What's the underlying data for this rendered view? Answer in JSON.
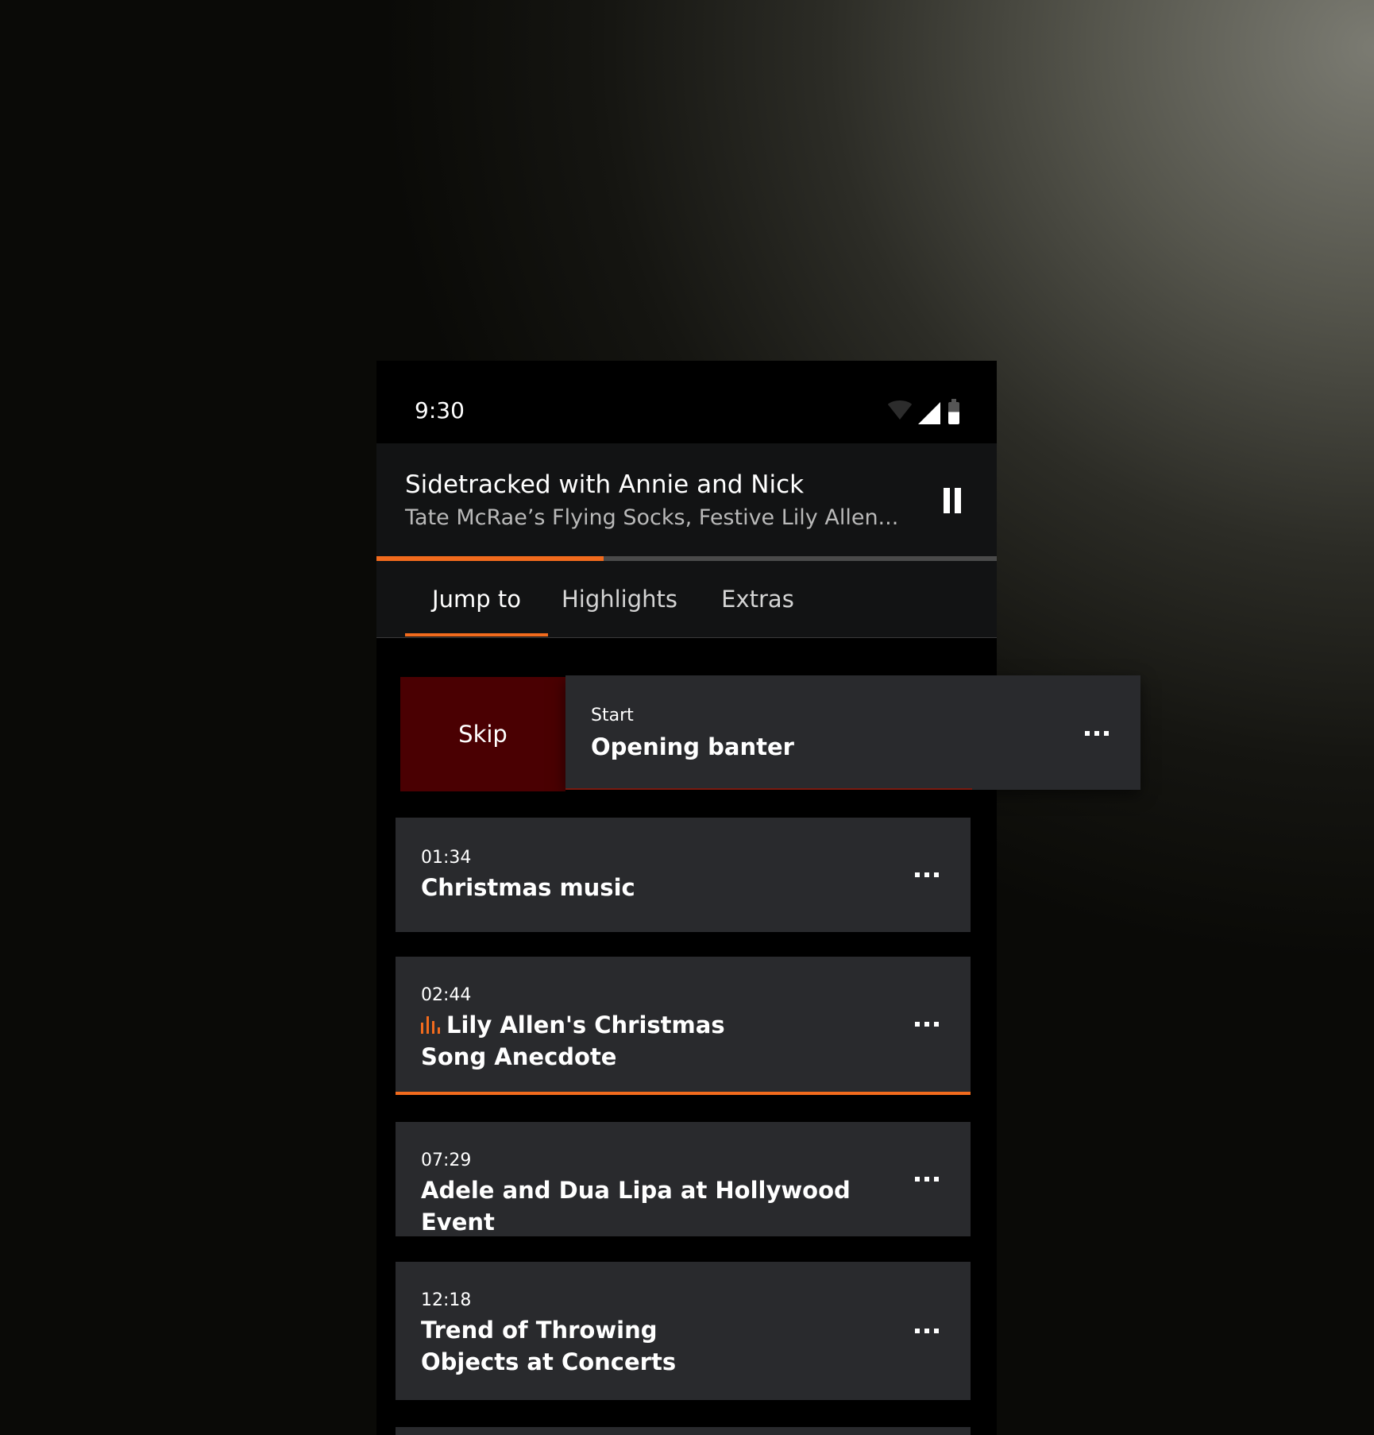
{
  "status_bar": {
    "time": "9:30",
    "icons": [
      "wifi-icon",
      "signal-icon",
      "battery-icon"
    ]
  },
  "now_playing": {
    "title": "Sidetracked with Annie and Nick",
    "subtitle": "Tate McRae’s Flying Socks, Festive Lily Allen...",
    "progress_fraction": 0.366,
    "pause_icon": "pause-icon"
  },
  "tabs": [
    {
      "label": "Jump to",
      "active": true
    },
    {
      "label": "Highlights",
      "active": false
    },
    {
      "label": "Extras",
      "active": false
    }
  ],
  "swipe_item": {
    "action_label": "Skip",
    "time": "Start",
    "title": "Opening banter"
  },
  "segments": [
    {
      "time": "01:34",
      "title": "Christmas music",
      "current": false
    },
    {
      "time": "02:44",
      "title": "Lily Allen's Christmas Song Anecdote",
      "current": true
    },
    {
      "time": "07:29",
      "title": "Adele and Dua Lipa at Hollywood Event",
      "current": false
    },
    {
      "time": "12:18",
      "title": "Trend of Throwing Objects at Concerts",
      "current": false
    }
  ],
  "colors": {
    "accent": "#f26b1d",
    "skip_background": "#4a0002",
    "card_background": "#292a2d",
    "header_background": "#121314"
  }
}
